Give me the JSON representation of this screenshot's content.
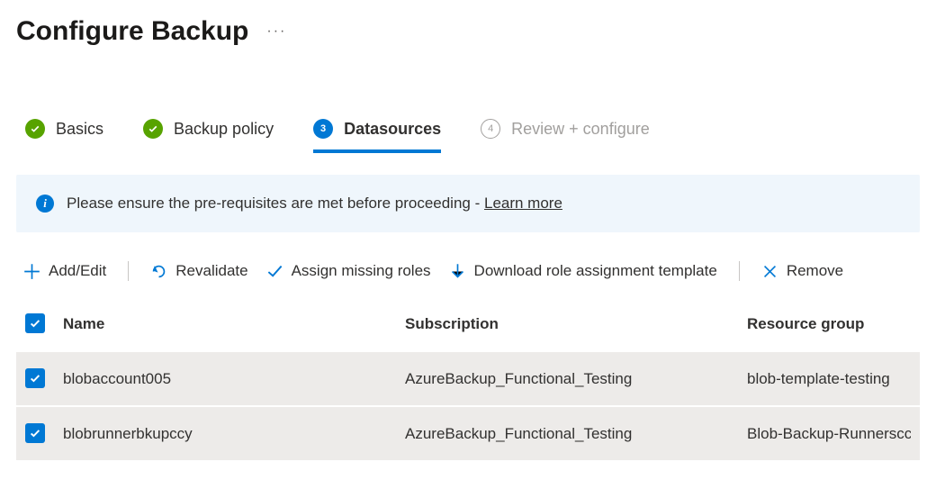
{
  "page": {
    "title": "Configure Backup"
  },
  "steps": [
    {
      "label": "Basics",
      "state": "done"
    },
    {
      "label": "Backup policy",
      "state": "done"
    },
    {
      "label": "Datasources",
      "state": "current",
      "number": "3"
    },
    {
      "label": "Review + configure",
      "state": "future",
      "number": "4"
    }
  ],
  "info": {
    "text": "Please ensure the pre-requisites are met before proceeding - ",
    "link": "Learn more"
  },
  "toolbar": {
    "add_edit": "Add/Edit",
    "revalidate": "Revalidate",
    "assign_roles": "Assign missing roles",
    "download_template": "Download role assignment template",
    "remove": "Remove"
  },
  "table": {
    "headers": {
      "name": "Name",
      "subscription": "Subscription",
      "resource_group": "Resource group"
    },
    "rows": [
      {
        "checked": true,
        "name": "blobaccount005",
        "subscription": "AzureBackup_Functional_Testing",
        "resource_group": "blob-template-testing"
      },
      {
        "checked": true,
        "name": "blobrunnerbkupccy",
        "subscription": "AzureBackup_Functional_Testing",
        "resource_group": "Blob-Backup-Runnersccy"
      }
    ]
  },
  "colors": {
    "accent": "#0078d4",
    "green": "#57a300"
  }
}
